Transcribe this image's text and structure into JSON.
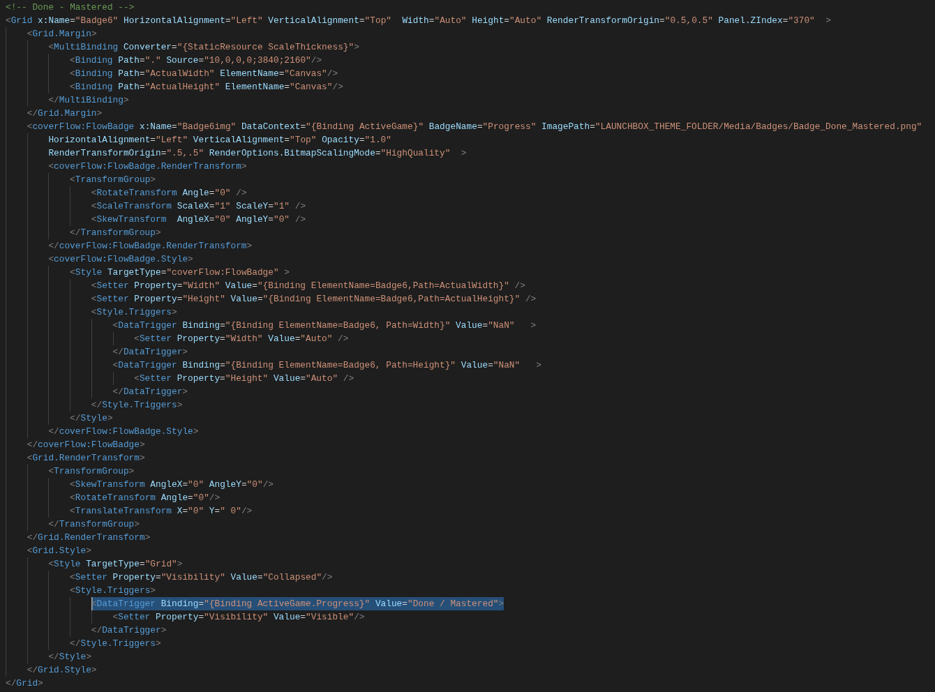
{
  "lines": [
    {
      "code": "<!-- Done - Mastered -->",
      "selected": false
    },
    {
      "code": "<Grid x:Name=\"Badge6\" HorizontalAlignment=\"Left\" VerticalAlignment=\"Top\"  Width=\"Auto\" Height=\"Auto\" RenderTransformOrigin=\"0.5,0.5\" Panel.ZIndex=\"370\"  >",
      "selected": false,
      "children": [
        {
          "code": "<Grid.Margin>",
          "selected": false,
          "children": [
            {
              "code": "<MultiBinding Converter=\"{StaticResource ScaleThickness}\">",
              "selected": false,
              "children": [
                {
                  "code": "<Binding Path=\".\" Source=\"10,0,0,0;3840;2160\"/>",
                  "selected": false
                },
                {
                  "code": "<Binding Path=\"ActualWidth\" ElementName=\"Canvas\"/>",
                  "selected": false
                },
                {
                  "code": "<Binding Path=\"ActualHeight\" ElementName=\"Canvas\"/>",
                  "selected": false
                }
              ]
            },
            {
              "code": "</MultiBinding>",
              "selected": false
            }
          ]
        },
        {
          "code": "</Grid.Margin>",
          "selected": false
        },
        {
          "code": "<coverFlow:FlowBadge x:Name=\"Badge6img\" DataContext=\"{Binding ActiveGame}\" BadgeName=\"Progress\" ImagePath=\"LAUNCHBOX_THEME_FOLDER/Media/Badges/Badge_Done_Mastered.png\"",
          "selected": false,
          "children": [
            {
              "code": "HorizontalAlignment=\"Left\" VerticalAlignment=\"Top\" Opacity=\"1.0\"",
              "selected": false
            },
            {
              "code": "RenderTransformOrigin=\".5,.5\" RenderOptions.BitmapScalingMode=\"HighQuality\"  >",
              "selected": false
            },
            {
              "code": "<coverFlow:FlowBadge.RenderTransform>",
              "selected": false,
              "children": [
                {
                  "code": "<TransformGroup>",
                  "selected": false,
                  "children": [
                    {
                      "code": "<RotateTransform Angle=\"0\" />",
                      "selected": false
                    },
                    {
                      "code": "<ScaleTransform ScaleX=\"1\" ScaleY=\"1\" />",
                      "selected": false
                    },
                    {
                      "code": "<SkewTransform  AngleX=\"0\" AngleY=\"0\" />",
                      "selected": false
                    }
                  ]
                },
                {
                  "code": "</TransformGroup>",
                  "selected": false
                }
              ]
            },
            {
              "code": "</coverFlow:FlowBadge.RenderTransform>",
              "selected": false
            },
            {
              "code": "<coverFlow:FlowBadge.Style>",
              "selected": false,
              "children": [
                {
                  "code": "<Style TargetType=\"coverFlow:FlowBadge\" >",
                  "selected": false,
                  "children": [
                    {
                      "code": "<Setter Property=\"Width\" Value=\"{Binding ElementName=Badge6,Path=ActualWidth}\" />",
                      "selected": false
                    },
                    {
                      "code": "<Setter Property=\"Height\" Value=\"{Binding ElementName=Badge6,Path=ActualHeight}\" />",
                      "selected": false
                    },
                    {
                      "code": "<Style.Triggers>",
                      "selected": false,
                      "children": [
                        {
                          "code": "<DataTrigger Binding=\"{Binding ElementName=Badge6, Path=Width}\" Value=\"NaN\"   >",
                          "selected": false,
                          "children": [
                            {
                              "code": "<Setter Property=\"Width\" Value=\"Auto\" />",
                              "selected": false
                            }
                          ]
                        },
                        {
                          "code": "</DataTrigger>",
                          "selected": false
                        },
                        {
                          "code": "<DataTrigger Binding=\"{Binding ElementName=Badge6, Path=Height}\" Value=\"NaN\"   >",
                          "selected": false,
                          "children": [
                            {
                              "code": "<Setter Property=\"Height\" Value=\"Auto\" />",
                              "selected": false
                            }
                          ]
                        },
                        {
                          "code": "</DataTrigger>",
                          "selected": false
                        }
                      ]
                    },
                    {
                      "code": "</Style.Triggers>",
                      "selected": false
                    }
                  ]
                },
                {
                  "code": "</Style>",
                  "selected": false
                }
              ]
            },
            {
              "code": "</coverFlow:FlowBadge.Style>",
              "selected": false
            }
          ]
        },
        {
          "code": "</coverFlow:FlowBadge>",
          "selected": false
        },
        {
          "code": "<Grid.RenderTransform>",
          "selected": false,
          "children": [
            {
              "code": "<TransformGroup>",
              "selected": false,
              "children": [
                {
                  "code": "<SkewTransform AngleX=\"0\" AngleY=\"0\"/>",
                  "selected": false
                },
                {
                  "code": "<RotateTransform Angle=\"0\"/>",
                  "selected": false
                },
                {
                  "code": "<TranslateTransform X=\"0\" Y=\" 0\"/>",
                  "selected": false
                }
              ]
            },
            {
              "code": "</TransformGroup>",
              "selected": false
            }
          ]
        },
        {
          "code": "</Grid.RenderTransform>",
          "selected": false
        },
        {
          "code": "<Grid.Style>",
          "selected": false,
          "children": [
            {
              "code": "<Style TargetType=\"Grid\">",
              "selected": false,
              "children": [
                {
                  "code": "<Setter Property=\"Visibility\" Value=\"Collapsed\"/>",
                  "selected": false
                },
                {
                  "code": "<Style.Triggers>",
                  "selected": false,
                  "children": [
                    {
                      "code": "<DataTrigger Binding=\"{Binding ActiveGame.Progress}\" Value=\"Done / Mastered\">",
                      "selected": true,
                      "children": [
                        {
                          "code": "<Setter Property=\"Visibility\" Value=\"Visible\"/>",
                          "selected": false
                        }
                      ]
                    },
                    {
                      "code": "</DataTrigger>",
                      "selected": false
                    }
                  ]
                },
                {
                  "code": "</Style.Triggers>",
                  "selected": false
                }
              ]
            },
            {
              "code": "</Style>",
              "selected": false
            }
          ]
        },
        {
          "code": "</Grid.Style>",
          "selected": false
        }
      ]
    },
    {
      "code": "</Grid>",
      "selected": false
    }
  ]
}
